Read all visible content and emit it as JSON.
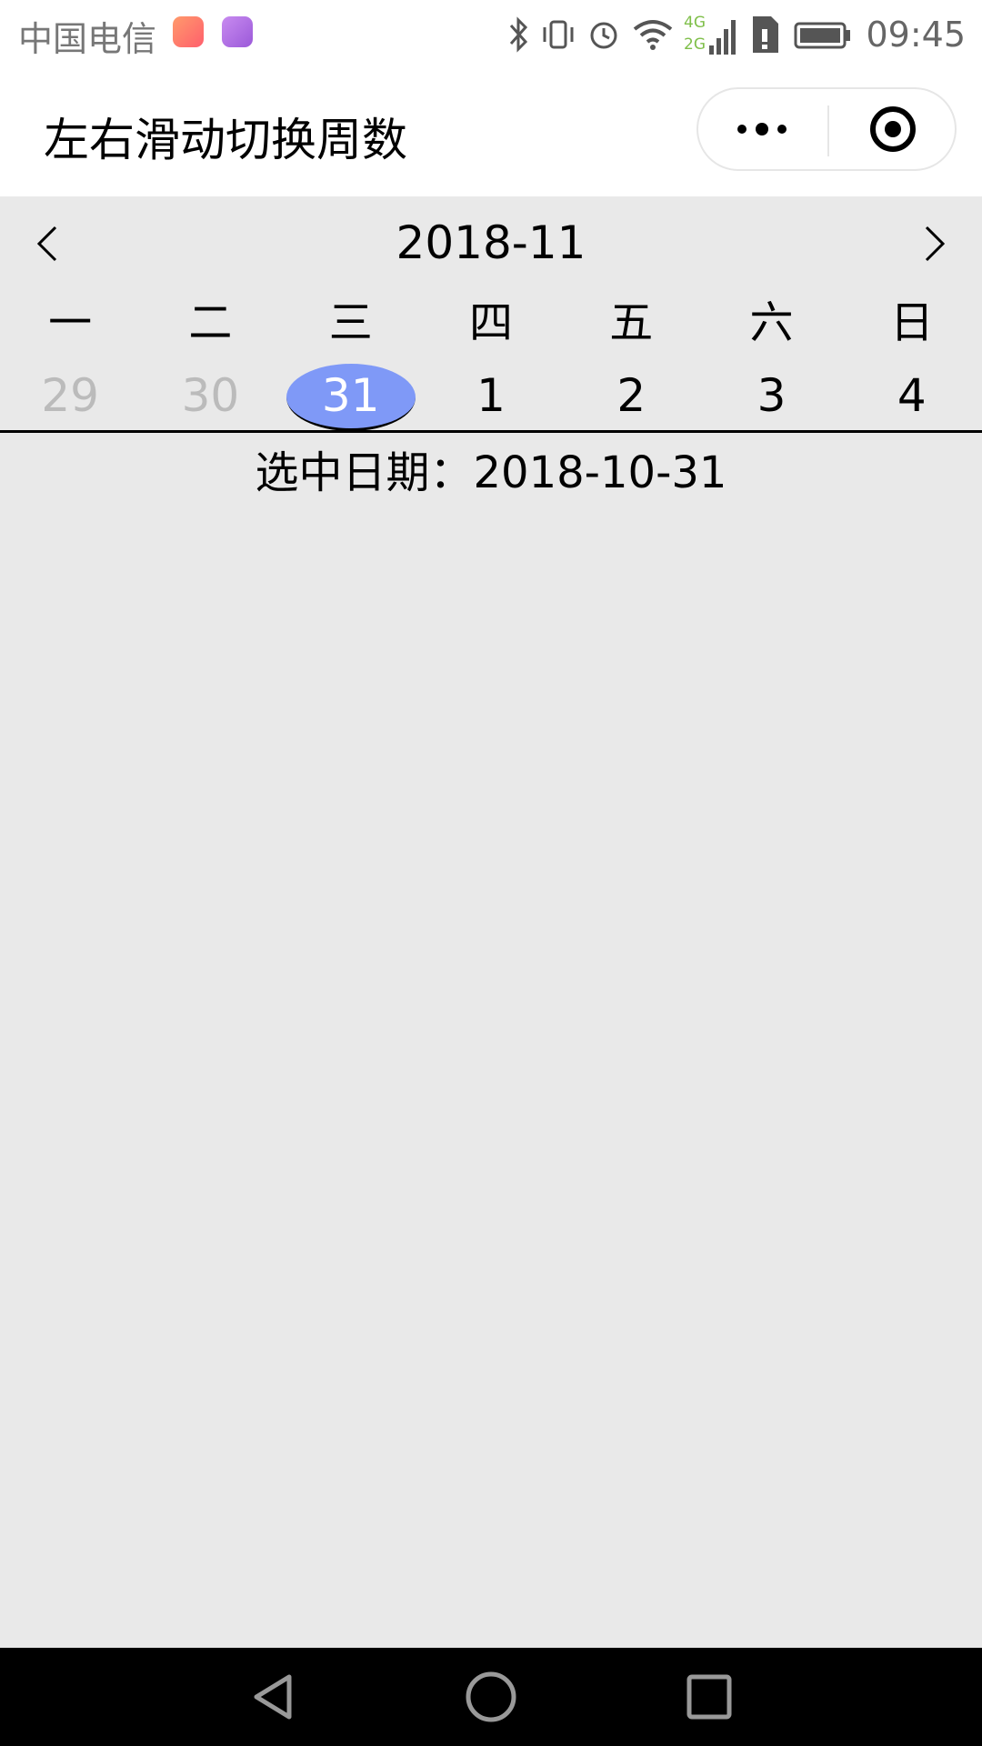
{
  "status_bar": {
    "carrier": "中国电信",
    "network_top": "4G",
    "network_bottom": "2G",
    "time": "09:45",
    "icons": [
      "health-app-icon",
      "gallery-app-icon",
      "bluetooth-icon",
      "vibrate-icon",
      "alarm-icon",
      "wifi-icon",
      "signal-icon",
      "sim-icon",
      "battery-icon"
    ]
  },
  "header": {
    "title": "左右滑动切换周数",
    "capsule_icons": [
      "more-icon",
      "close-target-icon"
    ]
  },
  "calendar": {
    "month": "2018-11",
    "weekdays": [
      "一",
      "二",
      "三",
      "四",
      "五",
      "六",
      "日"
    ],
    "days": [
      {
        "label": "29",
        "other_month": true,
        "selected": false
      },
      {
        "label": "30",
        "other_month": true,
        "selected": false
      },
      {
        "label": "31",
        "other_month": false,
        "selected": true
      },
      {
        "label": "1",
        "other_month": false,
        "selected": false
      },
      {
        "label": "2",
        "other_month": false,
        "selected": false
      },
      {
        "label": "3",
        "other_month": false,
        "selected": false
      },
      {
        "label": "4",
        "other_month": false,
        "selected": false
      }
    ],
    "selected_label": "选中日期：2018-10-31",
    "colors": {
      "selected_bg": "#7f99f7",
      "other_month_text": "#bbbbbb"
    }
  },
  "navigation_bar": {
    "buttons": [
      "back-triangle-icon",
      "home-circle-icon",
      "recent-square-icon"
    ]
  }
}
